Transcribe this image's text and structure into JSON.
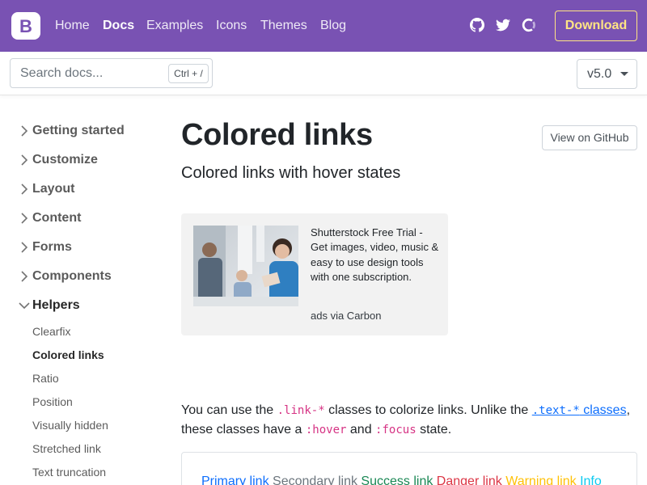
{
  "navbar": {
    "brand": "B",
    "links": [
      "Home",
      "Docs",
      "Examples",
      "Icons",
      "Themes",
      "Blog"
    ],
    "icons": [
      "github-icon",
      "twitter-icon",
      "opencollective-icon"
    ],
    "download_label": "Download",
    "colors": {
      "background": "#7952b3",
      "download": "#ffe484"
    }
  },
  "subnav": {
    "search_placeholder": "Search docs...",
    "search_shortcut": "Ctrl + /",
    "version_label": "v5.0"
  },
  "sidebar": {
    "sections": [
      "Getting started",
      "Customize",
      "Layout",
      "Content",
      "Forms",
      "Components",
      "Helpers"
    ],
    "expanded_section": "Helpers",
    "helpers_items": [
      "Clearfix",
      "Colored links",
      "Ratio",
      "Position",
      "Visually hidden",
      "Stretched link",
      "Text truncation"
    ],
    "active_item": "Colored links"
  },
  "main": {
    "title": "Colored links",
    "lead": "Colored links with hover states",
    "github_button": "View on GitHub",
    "ad": {
      "text": "Shutterstock Free Trial - Get images, video, music & easy to use design tools with one subscription.",
      "via": "ads via Carbon"
    },
    "paragraph": {
      "p1": "You can use the ",
      "code1": ".link-*",
      "p2": " classes to colorize links. Unlike the ",
      "link_code": ".text-*",
      "link_text": " classes",
      "p3": ",",
      "p4": "these classes have a ",
      "code2": ":hover",
      "p5": " and ",
      "code3": ":focus",
      "p6": " state."
    },
    "example_links": [
      {
        "label": "Primary link",
        "color": "#0d6efd"
      },
      {
        "label": "Secondary link",
        "color": "#6c757d"
      },
      {
        "label": "Success link",
        "color": "#198754"
      },
      {
        "label": "Danger link",
        "color": "#dc3545"
      },
      {
        "label": "Warning link",
        "color": "#ffc107"
      },
      {
        "label": "Info",
        "color": "#0dcaf0"
      }
    ]
  }
}
